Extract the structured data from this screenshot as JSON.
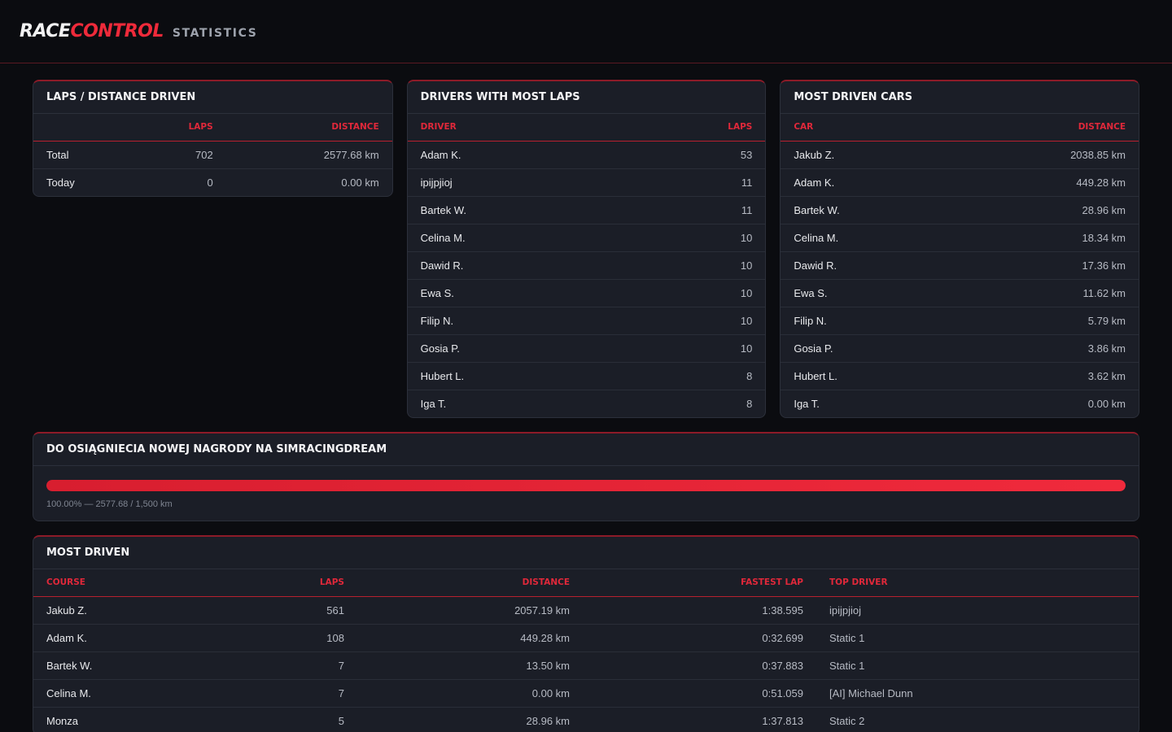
{
  "header": {
    "logo_part1": "RACE",
    "logo_part2": "CONTROL",
    "subtitle": "STATISTICS",
    "accent_color": "#ef2a3a"
  },
  "laps_distance": {
    "title": "LAPS / DISTANCE DRIVEN",
    "columns": [
      "",
      "LAPS",
      "DISTANCE"
    ],
    "rows": [
      {
        "label": "Total",
        "laps": "702",
        "distance": "2577.68 km"
      },
      {
        "label": "Today",
        "laps": "0",
        "distance": "0.00 km"
      }
    ]
  },
  "drivers_most_laps": {
    "title": "DRIVERS WITH MOST LAPS",
    "columns": [
      "DRIVER",
      "LAPS"
    ],
    "rows": [
      {
        "driver": "Adam K.",
        "laps": "53"
      },
      {
        "driver": "ipijpjioj",
        "laps": "11"
      },
      {
        "driver": "Bartek W.",
        "laps": "11"
      },
      {
        "driver": "Celina M.",
        "laps": "10"
      },
      {
        "driver": "Dawid R.",
        "laps": "10"
      },
      {
        "driver": "Ewa S.",
        "laps": "10"
      },
      {
        "driver": "Filip N.",
        "laps": "10"
      },
      {
        "driver": "Gosia P.",
        "laps": "10"
      },
      {
        "driver": "Hubert L.",
        "laps": "8"
      },
      {
        "driver": "Iga T.",
        "laps": "8"
      }
    ]
  },
  "most_driven_cars": {
    "title": "MOST DRIVEN CARS",
    "columns": [
      "CAR",
      "DISTANCE"
    ],
    "rows": [
      {
        "car": "Jakub Z.",
        "distance": "2038.85 km"
      },
      {
        "car": "Adam K.",
        "distance": "449.28 km"
      },
      {
        "car": "Bartek W.",
        "distance": "28.96 km"
      },
      {
        "car": "Celina M.",
        "distance": "18.34 km"
      },
      {
        "car": "Dawid R.",
        "distance": "17.36 km"
      },
      {
        "car": "Ewa S.",
        "distance": "11.62 km"
      },
      {
        "car": "Filip N.",
        "distance": "5.79 km"
      },
      {
        "car": "Gosia P.",
        "distance": "3.86 km"
      },
      {
        "car": "Hubert L.",
        "distance": "3.62 km"
      },
      {
        "car": "Iga T.",
        "distance": "0.00 km"
      }
    ]
  },
  "reward_progress": {
    "title": "DO OSIĄGNIECIA NOWEJ NAGRODY NA SIMRACINGDREAM",
    "percent": 100.0,
    "text": "100.00% — 2577.68 / 1,500 km"
  },
  "most_driven": {
    "title": "MOST DRIVEN",
    "columns": [
      "COURSE",
      "LAPS",
      "DISTANCE",
      "FASTEST LAP",
      "TOP DRIVER"
    ],
    "rows": [
      {
        "course": "Jakub Z.",
        "laps": "561",
        "distance": "2057.19 km",
        "fastest": "1:38.595",
        "top": "ipijpjioj"
      },
      {
        "course": "Adam K.",
        "laps": "108",
        "distance": "449.28 km",
        "fastest": "0:32.699",
        "top": "Static 1"
      },
      {
        "course": "Bartek W.",
        "laps": "7",
        "distance": "13.50 km",
        "fastest": "0:37.883",
        "top": "Static 1"
      },
      {
        "course": "Celina M.",
        "laps": "7",
        "distance": "0.00 km",
        "fastest": "0:51.059",
        "top": "[AI] Michael Dunn"
      },
      {
        "course": "Monza",
        "laps": "5",
        "distance": "28.96 km",
        "fastest": "1:37.813",
        "top": "Static 2"
      }
    ]
  }
}
